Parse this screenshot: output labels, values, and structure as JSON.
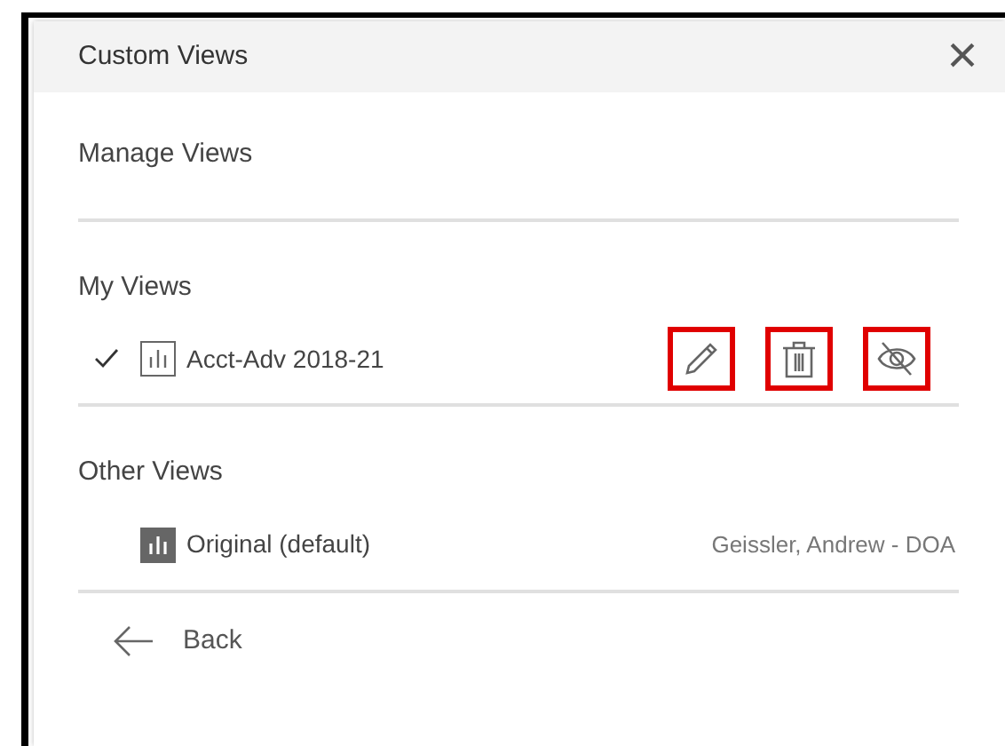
{
  "dialog": {
    "title": "Custom Views",
    "close": "×"
  },
  "manage": "Manage Views",
  "sections": [
    {
      "heading": "My Views",
      "views": [
        {
          "name": "Acct-Adv 2018-21",
          "selected": true,
          "default": false,
          "actions": [
            {
              "kind": "edit",
              "highlighted": true
            },
            {
              "kind": "delete",
              "highlighted": true
            },
            {
              "kind": "hide",
              "highlighted": true
            }
          ]
        }
      ]
    },
    {
      "heading": "Other Views",
      "views": [
        {
          "name": "Original (default)",
          "selected": false,
          "default": true,
          "owner": "Geissler, Andrew - DOA"
        }
      ]
    }
  ],
  "back": "Back"
}
